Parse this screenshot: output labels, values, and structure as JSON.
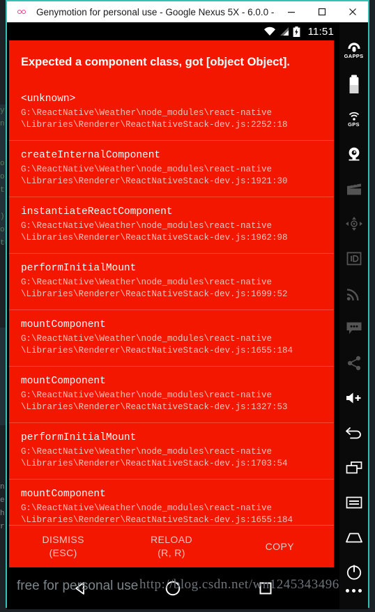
{
  "window": {
    "title": "Genymotion for personal use - Google Nexus 5X - 6.0.0 - ...",
    "logo_icon": "genymotion-logo-icon",
    "minimize_label": "—",
    "maximize_label": "☐",
    "close_label": "✕",
    "accent_border": "#34c1b0"
  },
  "status_bar": {
    "wifi_icon": "wifi-icon",
    "signal_icon": "cell-signal-icon",
    "battery_icon": "battery-charging-icon",
    "clock": "11:51"
  },
  "redbox": {
    "background": "#f31700",
    "title": "Expected a component class, got [object Object].",
    "frames": [
      {
        "method": "<unknown>",
        "location": "G:\\ReactNative\\Weather\\node_modules\\react-native\n\\Libraries\\Renderer\\ReactNativeStack-dev.js:2252:18"
      },
      {
        "method": "createInternalComponent",
        "location": "G:\\ReactNative\\Weather\\node_modules\\react-native\n\\Libraries\\Renderer\\ReactNativeStack-dev.js:1921:30"
      },
      {
        "method": "instantiateReactComponent",
        "location": "G:\\ReactNative\\Weather\\node_modules\\react-native\n\\Libraries\\Renderer\\ReactNativeStack-dev.js:1962:98"
      },
      {
        "method": "performInitialMount",
        "location": "G:\\ReactNative\\Weather\\node_modules\\react-native\n\\Libraries\\Renderer\\ReactNativeStack-dev.js:1699:52"
      },
      {
        "method": "mountComponent",
        "location": "G:\\ReactNative\\Weather\\node_modules\\react-native\n\\Libraries\\Renderer\\ReactNativeStack-dev.js:1655:184"
      },
      {
        "method": "mountComponent",
        "location": "G:\\ReactNative\\Weather\\node_modules\\react-native\n\\Libraries\\Renderer\\ReactNativeStack-dev.js:1327:53"
      },
      {
        "method": "performInitialMount",
        "location": "G:\\ReactNative\\Weather\\node_modules\\react-native\n\\Libraries\\Renderer\\ReactNativeStack-dev.js:1703:54"
      },
      {
        "method": "mountComponent",
        "location": "G:\\ReactNative\\Weather\\node_modules\\react-native\n\\Libraries\\Renderer\\ReactNativeStack-dev.js:1655:184"
      }
    ],
    "actions": [
      {
        "label": "DISMISS",
        "shortcut": "(ESC)"
      },
      {
        "label": "RELOAD",
        "shortcut": "(R, R)"
      },
      {
        "label": "COPY",
        "shortcut": ""
      }
    ]
  },
  "nav_bar": {
    "back_icon": "back-triangle-icon",
    "home_icon": "home-circle-icon",
    "recents_icon": "recents-square-icon"
  },
  "gm_toolbar": {
    "items": [
      {
        "icon": "gapps-icon",
        "label": "GAPPS",
        "dim": false
      },
      {
        "icon": "battery-widget-icon",
        "label": "",
        "dim": false
      },
      {
        "icon": "gps-icon",
        "label": "GPS",
        "dim": false
      },
      {
        "icon": "camera-icon",
        "label": "",
        "dim": false
      },
      {
        "icon": "clapperboard-icon",
        "label": "",
        "dim": true
      },
      {
        "icon": "dpad-icon",
        "label": "",
        "dim": true
      },
      {
        "icon": "id-badge-icon",
        "label": "",
        "dim": true
      },
      {
        "icon": "network-signal-icon",
        "label": "",
        "dim": true
      },
      {
        "icon": "sms-bubble-icon",
        "label": "",
        "dim": true
      },
      {
        "icon": "share-icon",
        "label": "",
        "dim": true
      },
      {
        "icon": "volume-up-icon",
        "label": "",
        "dim": false
      },
      {
        "icon": "rotate-back-icon",
        "label": "",
        "dim": false
      },
      {
        "icon": "copy-windows-icon",
        "label": "",
        "dim": false
      },
      {
        "icon": "menu-lines-icon",
        "label": "",
        "dim": false
      },
      {
        "icon": "home-pentagon-icon",
        "label": "",
        "dim": false
      },
      {
        "icon": "power-icon",
        "label": "",
        "dim": false
      }
    ],
    "more_icon": "more-dots-icon"
  },
  "watermarks": {
    "genymotion": "free for personal use",
    "url": "http://blog.csdn.net/wn1245343496"
  },
  "background": {
    "code_left": "y\nn\n\n\no\no\nt\n\n)\no\nt",
    "code_bottom": "n\ne\nh\nr"
  }
}
